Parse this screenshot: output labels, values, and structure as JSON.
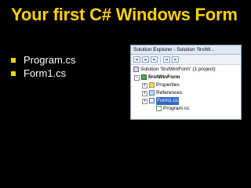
{
  "slide": {
    "title": "Your first C# Windows Form",
    "bullets": [
      "Program.cs",
      "Form1.cs"
    ]
  },
  "colors": {
    "background": "#000000",
    "title": "#ffd200",
    "bullet_marker": "#ffd200",
    "selection": "#316ac5"
  },
  "solution_explorer": {
    "title": "Solution Explorer - Solution 'firstW...",
    "toolbar_icons": [
      "properties-icon",
      "show-all-files-icon",
      "refresh-icon",
      "view-code-icon",
      "view-designer-icon"
    ],
    "tree": {
      "solution_label": "Solution 'firstWinForm' (1 project)",
      "project_label": "firstWinForm",
      "items": [
        {
          "label": "Properties",
          "icon": "folder-icon",
          "expander": "+"
        },
        {
          "label": "References",
          "icon": "references-icon",
          "expander": "+"
        },
        {
          "label": "Form1.cs",
          "icon": "form-icon",
          "expander": "+",
          "selected": true
        },
        {
          "label": "Program.cs",
          "icon": "csharp-file-icon"
        }
      ]
    }
  }
}
